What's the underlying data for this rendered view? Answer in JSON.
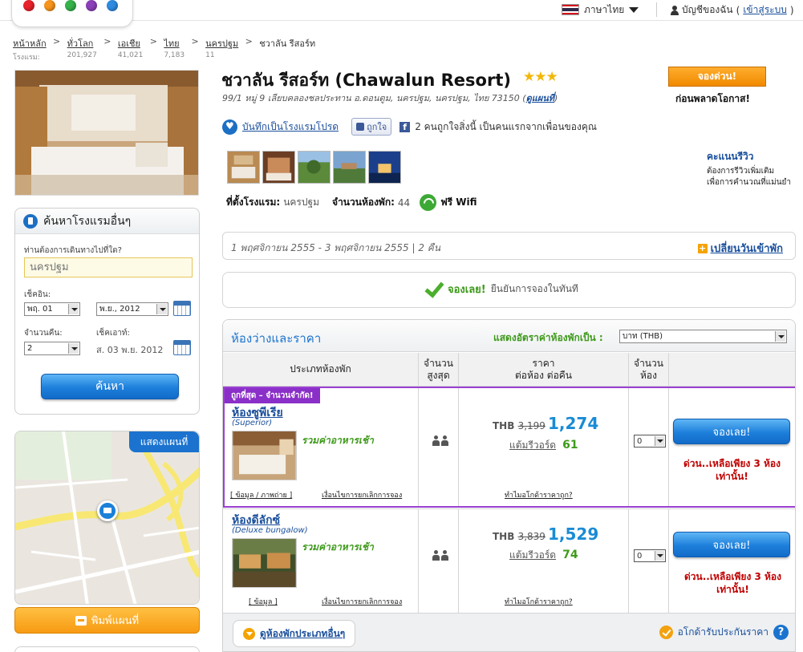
{
  "topbar": {
    "language": "ภาษาไทย",
    "account": "บัญชีของฉัน",
    "login": "เข้าสู่ระบบ",
    "colors": [
      "#e8232b",
      "#f7941d",
      "#36b24a",
      "#8b3fb8",
      "#2e8be0"
    ]
  },
  "breadcrumb": {
    "count_prefix": "โรงแรม:",
    "items": [
      {
        "label": "หน้าหลัก",
        "count": ""
      },
      {
        "label": "ทั่วโลก",
        "count": "201,927"
      },
      {
        "label": "เอเชีย",
        "count": "41,021"
      },
      {
        "label": "ไทย",
        "count": "7,183"
      },
      {
        "label": "นครปฐม",
        "count": "11"
      }
    ],
    "current": "ชวาลัน รีสอร์ท"
  },
  "search": {
    "title": "ค้นหาโรงแรมอื่นๆ",
    "where_label": "ท่านต้องการเดินทางไปที่ใด?",
    "destination_placeholder": "นครปฐม",
    "checkin_label": "เช็คอิน:",
    "checkin_day": "พฤ. 01",
    "checkin_month": "พ.ย., 2012",
    "nights_label": "จำนวนคืน:",
    "nights": "2",
    "checkout_label": "เช็คเอาท์:",
    "checkout_date": "ส. 03 พ.ย. 2012",
    "button": "ค้นหา"
  },
  "map": {
    "show_map": "แสดงแผนที่",
    "print_map": "พิมพ์แผนที่"
  },
  "hotel": {
    "name": "ชวาลัน รีสอร์ท (Chawalun Resort)",
    "stars": "★★★",
    "address": "99/1 หมู่ 9 เลียบคลองชลประทาน อ.ดอนตูม, นครปฐม, นครปฐม, ไทย 73150",
    "map_link": "ดูแผนที่",
    "book_now": "จองด่วน!",
    "before_miss": "ก่อนพลาดโอกาส!",
    "save_favorite": "บันทึกเป็นโรงแรมโปรด",
    "like_button": "ถูกใจ",
    "like_text": "2 คนถูกใจสิ่งนี้ เป็นคนแรกจากเพื่อนของคุณ",
    "review_title": "คะแนนรีวิว",
    "review_sub1": "ต้องการรีวิวเพิ่มเติม",
    "review_sub2": "เพื่อการคำนวณที่แม่นยำ",
    "location_label": "ที่ตั้งโรงแรม:",
    "location": "นครปฐม",
    "rooms_label": "จำนวนห้องพัก:",
    "rooms_count": "44",
    "wifi": "ฟรี Wifi"
  },
  "dates": {
    "text": "1 พฤศจิกายน 2555 - 3 พฤศจิกายน 2555 | 2 คืน",
    "change": "เปลี่ยนวันเข้าพัก"
  },
  "confirm": {
    "green": "จองเลย!",
    "gray": "ยืนยันการจองในทันที"
  },
  "rooms": {
    "title": "ห้องว่างและราคา",
    "rate_label": "แสดงอัตราค่าห้องพักเป็น :",
    "currency": "บาท (THB)",
    "headers": {
      "type": "ประเภทห้องพัก",
      "max_1": "จำนวน",
      "max_2": "สูงสุด",
      "price_1": "ราคา",
      "price_2": "ต่อห้อง ต่อคืน",
      "qty_1": "จำนวน",
      "qty_2": "ห้อง"
    },
    "list": [
      {
        "promo": "ถูกที่สุด – จำนวนจำกัด!",
        "name": "ห้องซูพีเรีย",
        "sub": "(Superior)",
        "breakfast": "รวมค่าอาหารเช้า",
        "info_link": "[ ข้อมูล / ภาพถ่าย ]",
        "conditions": "เงื่อนไขการยกเลิกการจอง",
        "currency": "THB",
        "old_price": "3,199",
        "price": "1,274",
        "points_label": "แต้มรีวอร์ด",
        "points": "61",
        "why_cheap": "ทำไมอโกด้าราคาถูก?",
        "qty": "0",
        "book": "จองเลย!",
        "urgent_1": "ด่วน..เหลือเพียง 3 ห้อง",
        "urgent_2": "เท่านั้น!"
      },
      {
        "promo": "",
        "name": "ห้องดีลักซ์",
        "sub": "(Deluxe bungalow)",
        "breakfast": "รวมค่าอาหารเช้า",
        "info_link": "[ ข้อมูล ]",
        "conditions": "เงื่อนไขการยกเลิกการจอง",
        "currency": "THB",
        "old_price": "3,839",
        "price": "1,529",
        "points_label": "แต้มรีวอร์ด",
        "points": "74",
        "why_cheap": "ทำไมอโกด้าราคาถูก?",
        "qty": "0",
        "book": "จองเลย!",
        "urgent_1": "ด่วน..เหลือเพียง 3 ห้อง",
        "urgent_2": "เท่านั้น!"
      }
    ],
    "other_rooms": "ดูห้องพักประเภทอื่นๆ",
    "guarantee": "อโกด้ารับประกันราคา",
    "help": "?"
  }
}
